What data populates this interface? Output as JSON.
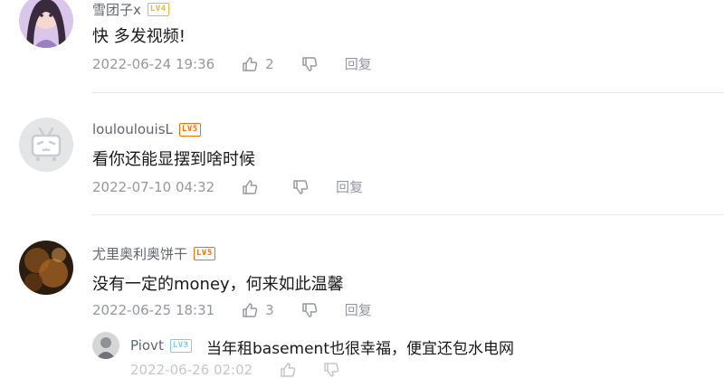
{
  "comments": [
    {
      "username": "雪团子x",
      "level": "LV4",
      "level_color": "#ffb027",
      "text": "快 多发视频!",
      "time": "2022-06-24 19:36",
      "likes": "2",
      "reply_label": "回复"
    },
    {
      "username": "louloulouisL",
      "level": "LV5",
      "level_color": "#ff6c00",
      "text": "看你还能显摆到啥时候",
      "time": "2022-07-10 04:32",
      "likes": "",
      "reply_label": "回复"
    },
    {
      "username": "尤里奥利奥饼干",
      "level": "LV5",
      "level_color": "#ff6c00",
      "text": "没有一定的money，何来如此温馨",
      "time": "2022-06-25 18:31",
      "likes": "3",
      "reply_label": "回复",
      "sub_reply": {
        "username": "Piovt",
        "level": "LV3",
        "level_color": "#7bcdef",
        "text": "当年租basement也很幸福，便宜还包水电网",
        "time": "2022-06-26 02:02"
      }
    }
  ]
}
